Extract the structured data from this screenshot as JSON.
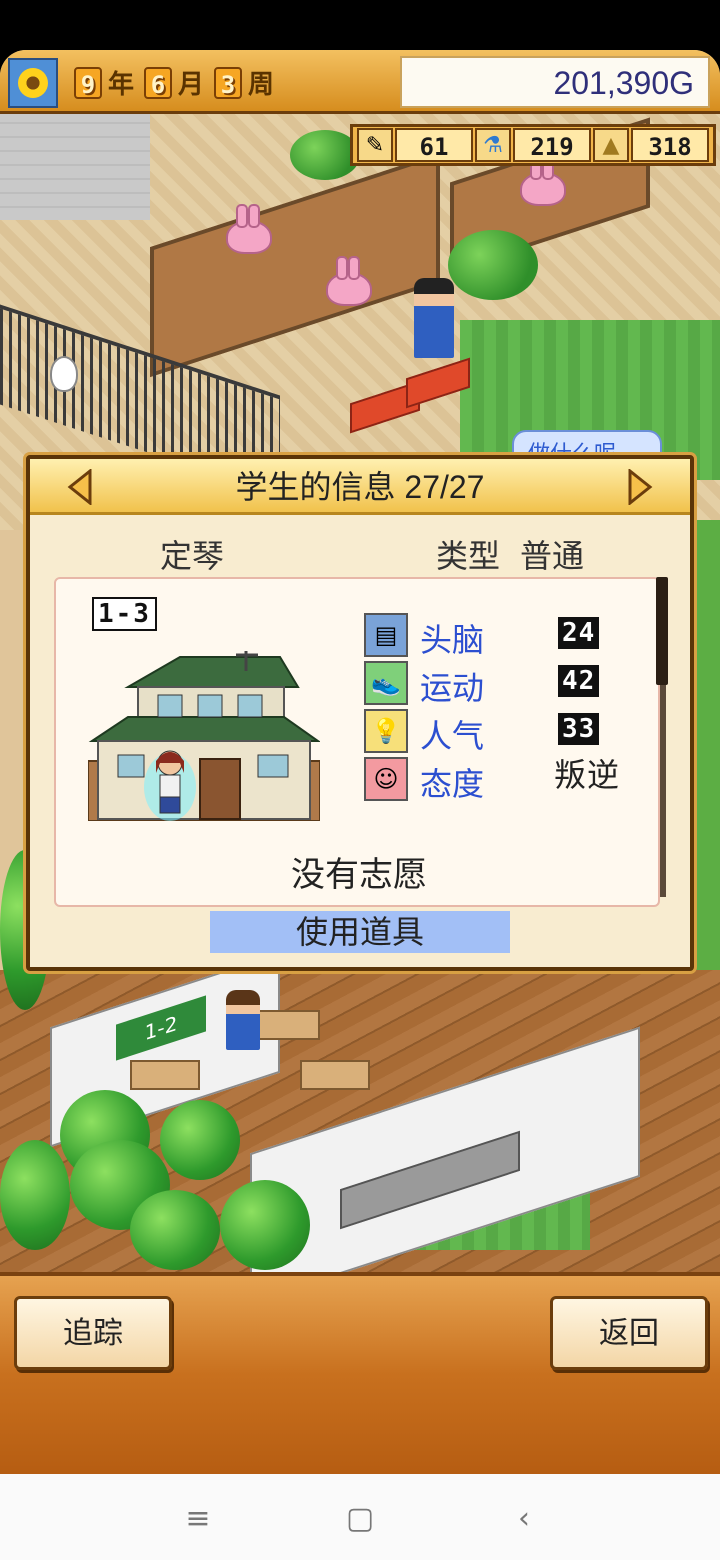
{
  "hud": {
    "year": "9",
    "year_unit": "年",
    "month": "6",
    "month_unit": "月",
    "week": "3",
    "week_unit": "周",
    "money": "201,390G"
  },
  "resources": [
    {
      "icon": "pencil-icon",
      "value": "61"
    },
    {
      "icon": "flask-icon",
      "value": "219"
    },
    {
      "icon": "pyramid-icon",
      "value": "318"
    }
  ],
  "bubble_text": "做什么呢",
  "dialog": {
    "title": "学生的信息 27/27",
    "student_name": "定琴",
    "type_label": "类型",
    "type_value": "普通",
    "class": "1-3",
    "stats": [
      {
        "icon": "brain-icon",
        "label": "头脑",
        "value": "24",
        "is_text": false,
        "color": "#7aa3d8"
      },
      {
        "icon": "sneaker-icon",
        "label": "运动",
        "value": "42",
        "is_text": false,
        "color": "#7fd07a"
      },
      {
        "icon": "lightbulb-icon",
        "label": "人气",
        "value": "33",
        "is_text": false,
        "color": "#f7e07a"
      },
      {
        "icon": "face-icon",
        "label": "态度",
        "value": "叛逆",
        "is_text": true,
        "color": "#f39aa0"
      }
    ],
    "aspiration": "没有志愿",
    "use_item_label": "使用道具"
  },
  "buttons": {
    "track": "追踪",
    "back": "返回"
  },
  "nav": {
    "menu": "≡",
    "home": "▢",
    "back": "‹"
  }
}
